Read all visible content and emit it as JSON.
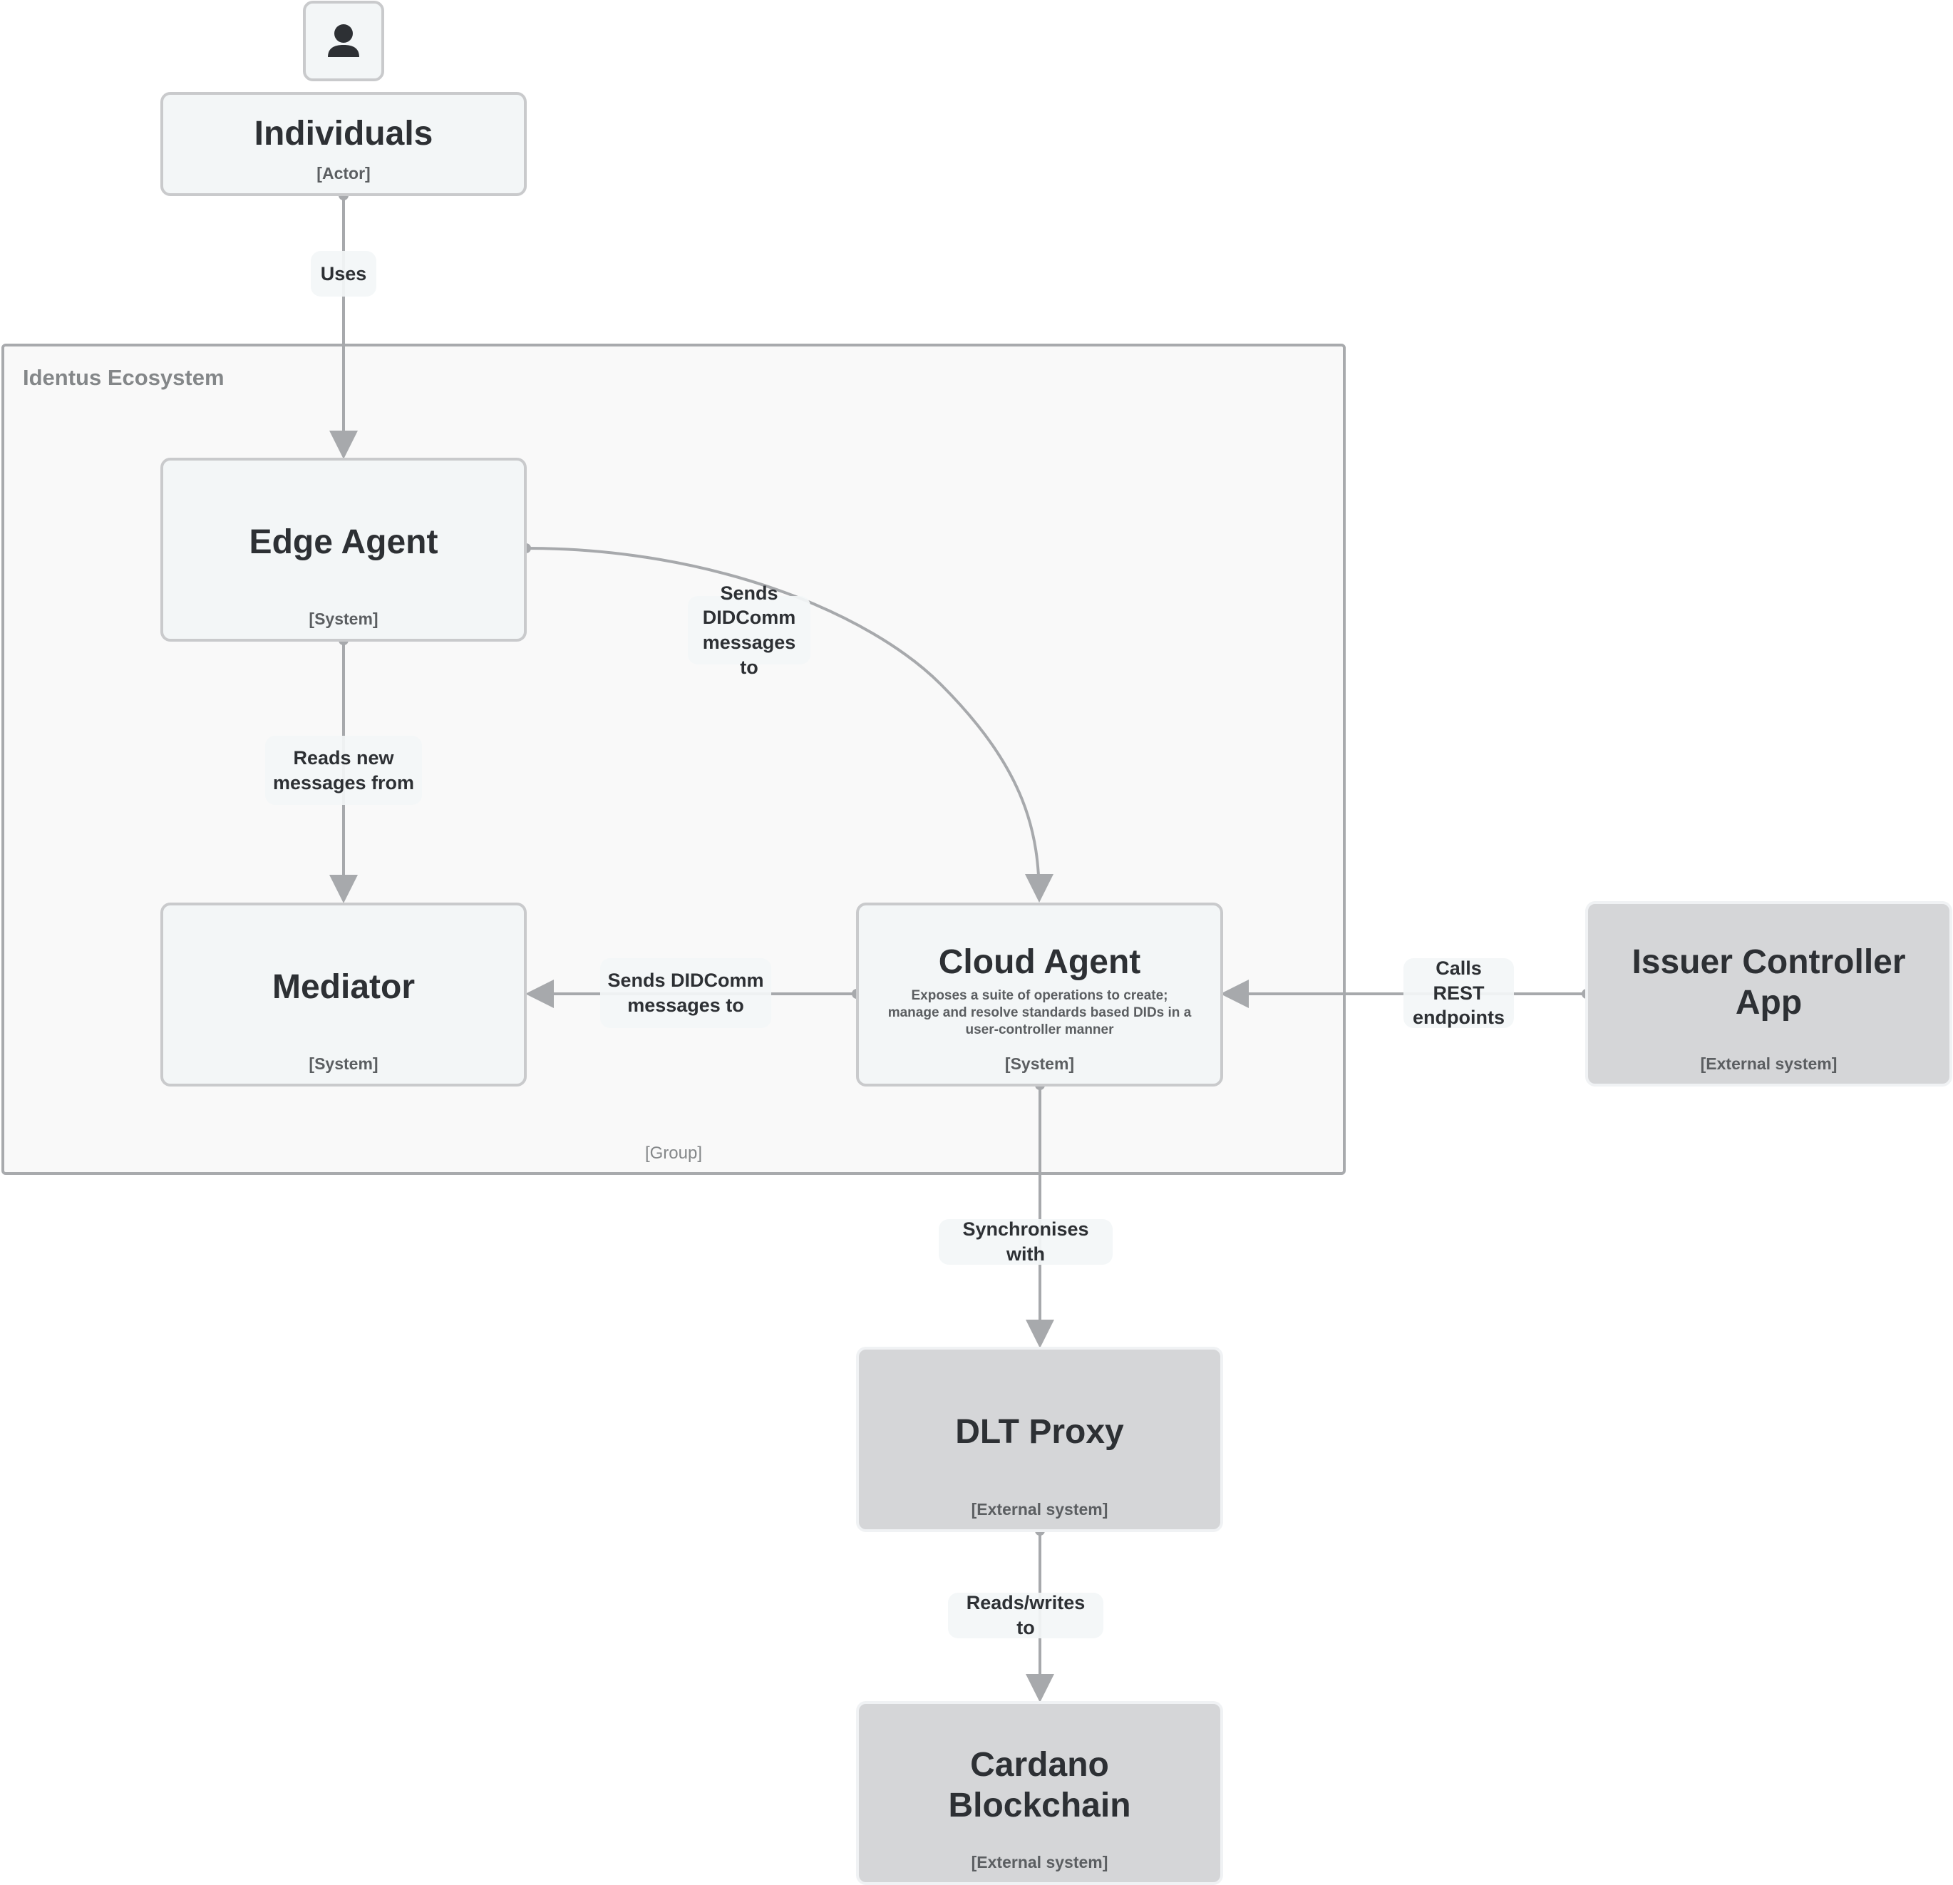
{
  "colors": {
    "edge": "#a7a9ac",
    "system_fill": "#f3f6f7",
    "external_fill": "#d5d6d8",
    "group_fill": "#f9f9f9",
    "text": "#2d3034"
  },
  "actor": {
    "icon": "person-icon",
    "title": "Individuals",
    "type": "[Actor]"
  },
  "group": {
    "title": "Identus Ecosystem",
    "type": "[Group]"
  },
  "nodes": {
    "edge_agent": {
      "title": "Edge Agent",
      "type": "[System]"
    },
    "mediator": {
      "title": "Mediator",
      "type": "[System]"
    },
    "cloud_agent": {
      "title": "Cloud Agent",
      "description": "Exposes a suite of operations to create; manage and resolve standards based DIDs in a user-controller manner",
      "type": "[System]"
    },
    "issuer_app": {
      "title": "Issuer Controller App",
      "type": "[External system]"
    },
    "dlt_proxy": {
      "title": "DLT Proxy",
      "type": "[External system]"
    },
    "cardano": {
      "title": "Cardano Blockchain",
      "type": "[External system]"
    }
  },
  "edges": [
    {
      "id": "uses",
      "from": "Individuals",
      "to": "Edge Agent",
      "label": "Uses"
    },
    {
      "id": "edge-to-cloud",
      "from": "Edge Agent",
      "to": "Cloud Agent",
      "label": "Sends DIDComm messages to"
    },
    {
      "id": "edge-reads-mediator",
      "from": "Edge Agent",
      "to": "Mediator",
      "label": "Reads new messages from"
    },
    {
      "id": "cloud-to-mediator",
      "from": "Cloud Agent",
      "to": "Mediator",
      "label": "Sends DIDComm messages to"
    },
    {
      "id": "issuer-to-cloud",
      "from": "Issuer Controller App",
      "to": "Cloud Agent",
      "label": "Calls REST endpoints"
    },
    {
      "id": "cloud-to-dlt",
      "from": "Cloud Agent",
      "to": "DLT Proxy",
      "label": "Synchronises with"
    },
    {
      "id": "dlt-to-cardano",
      "from": "DLT Proxy",
      "to": "Cardano Blockchain",
      "label": "Reads/writes to"
    }
  ]
}
